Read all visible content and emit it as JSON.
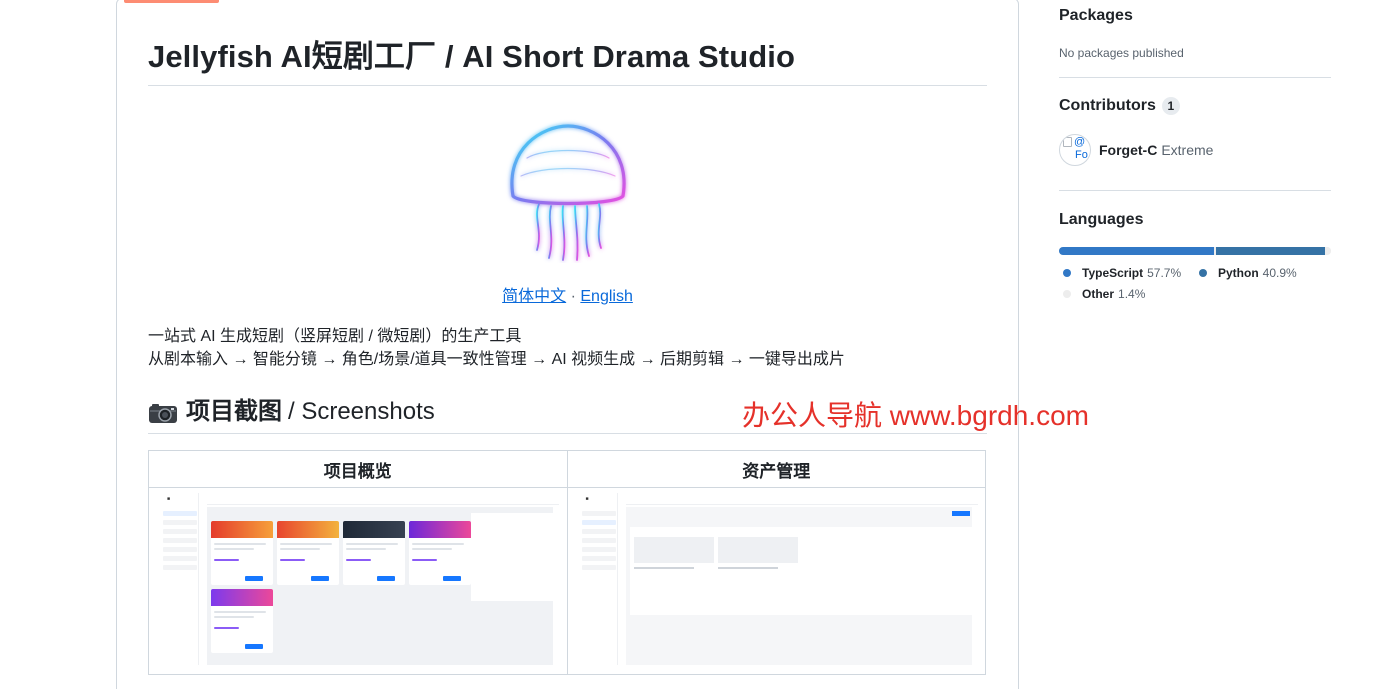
{
  "readme": {
    "title": "Jellyfish AI短剧工厂 / AI Short Drama Studio",
    "lang_links": {
      "zh": "简体中文",
      "sep": "·",
      "en": "English"
    },
    "description": [
      "一站式 AI 生成短剧（竖屏短剧 / 微短剧）的生产工具",
      "从剧本输入 → 智能分镜 → 角色/场景/道具一致性管理 → AI 视频生成 → 后期剪辑 → 一键导出成片"
    ],
    "screenshots_heading_zh": "项目截图",
    "screenshots_heading_sep": "/ Screenshots",
    "screenshot_table": {
      "headers": [
        "项目概览",
        "资产管理"
      ]
    }
  },
  "watermark": "办公人导航  www.bgrdh.com",
  "sidebar": {
    "packages": {
      "title": "Packages",
      "empty": "No packages published"
    },
    "contributors": {
      "title": "Contributors",
      "count": "1",
      "items": [
        {
          "login": "Forget-C",
          "name": "Extreme",
          "avatar_alt_a": "@",
          "avatar_alt_b": "Fo"
        }
      ]
    },
    "languages": {
      "title": "Languages",
      "items": [
        {
          "name": "TypeScript",
          "percent": "57.7%",
          "value": 57.7,
          "color": "#3178c6"
        },
        {
          "name": "Python",
          "percent": "40.9%",
          "value": 40.9,
          "color": "#3572A5"
        },
        {
          "name": "Other",
          "percent": "1.4%",
          "value": 1.4,
          "color": "#ededed"
        }
      ]
    }
  },
  "colors": {
    "link": "#0969da",
    "tab_underline": "#fd8c73",
    "watermark": "#e5312a"
  }
}
